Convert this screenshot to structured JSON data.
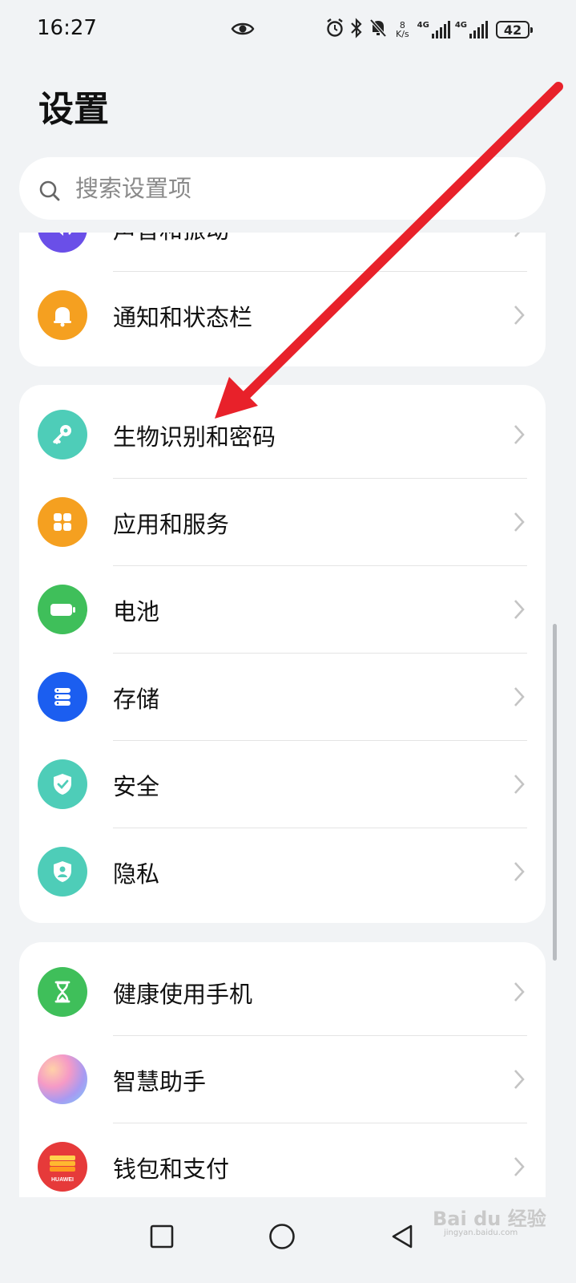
{
  "status_bar": {
    "time": "16:27",
    "net_speed_value": "8",
    "net_speed_unit": "K/s",
    "sim1_label": "4G",
    "sim2_label": "4G",
    "battery_level": "42",
    "icons": [
      "eye-icon",
      "alarm-icon",
      "bluetooth-icon",
      "mute-notification-icon",
      "signal-icon",
      "battery-icon"
    ]
  },
  "page": {
    "title": "设置"
  },
  "search": {
    "placeholder": "搜索设置项"
  },
  "groups": [
    {
      "items": [
        {
          "label": "声音和振动",
          "icon": "sound-icon",
          "color": "#6a4fe8"
        },
        {
          "label": "通知和状态栏",
          "icon": "bell-icon",
          "color": "#f5a020"
        }
      ]
    },
    {
      "items": [
        {
          "label": "生物识别和密码",
          "icon": "key-icon",
          "color": "#4ecdb8"
        },
        {
          "label": "应用和服务",
          "icon": "apps-icon",
          "color": "#f5a020"
        },
        {
          "label": "电池",
          "icon": "battery-icon",
          "color": "#3fbf5a"
        },
        {
          "label": "存储",
          "icon": "storage-icon",
          "color": "#1b5ef0"
        },
        {
          "label": "安全",
          "icon": "shield-check-icon",
          "color": "#4ecdb8"
        },
        {
          "label": "隐私",
          "icon": "privacy-shield-icon",
          "color": "#4ecdb8"
        }
      ]
    },
    {
      "items": [
        {
          "label": "健康使用手机",
          "icon": "hourglass-icon",
          "color": "#3fbf5a"
        },
        {
          "label": "智慧助手",
          "icon": "assistant-icon",
          "color": "#b08af0"
        },
        {
          "label": "钱包和支付",
          "icon": "wallet-icon",
          "color": "#e63a3a",
          "brand_text": "HUAWEI"
        }
      ]
    }
  ],
  "nav_bar": {
    "buttons": [
      "recent-apps",
      "home",
      "back"
    ]
  },
  "annotation": {
    "arrow_color": "#e8212a"
  },
  "watermark": {
    "text": "Bai du 经验",
    "sub": "jingyan.baidu.com"
  }
}
